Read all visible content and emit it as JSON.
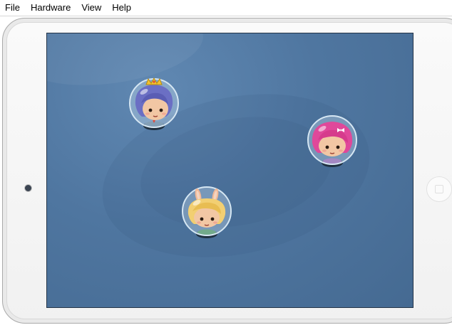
{
  "menubar": {
    "items": [
      {
        "label": "File"
      },
      {
        "label": "Hardware"
      },
      {
        "label": "View"
      },
      {
        "label": "Help"
      }
    ]
  },
  "device": {
    "type": "tablet-simulator",
    "screen_color": "#4f76a0"
  },
  "characters": [
    {
      "id": "queen",
      "hair_color": "#6b6fc4",
      "collar_color": "#5a7a94",
      "accent_icon": "crown-icon"
    },
    {
      "id": "pink",
      "hair_color": "#e0489a",
      "collar_color": "#8a57a8",
      "accent_icon": "bow-icon"
    },
    {
      "id": "bunny",
      "hair_color": "#f2cf72",
      "collar_color": "#3f8a52",
      "accent_icon": "bunny-ears-icon"
    }
  ]
}
